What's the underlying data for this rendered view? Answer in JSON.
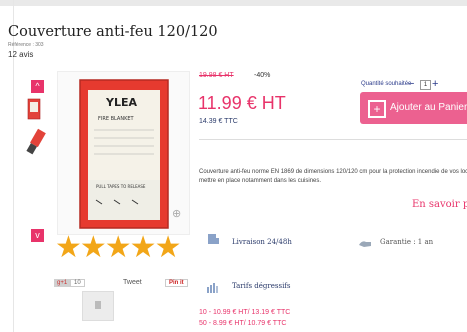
{
  "product": {
    "title": "Couverture anti-feu 120/120",
    "reference": "Référence : 303",
    "reviews": "12 avis",
    "rating_stars": 4.5
  },
  "gallery": {
    "up_arrow": "^",
    "down_arrow": "v",
    "zoom_symbol": "⊕",
    "stars_glyphs": "★★★★★",
    "packaging_brand": "YLEA",
    "packaging_subtitle": "FIRE BLANKET",
    "packaging_note": "PULL TAPES TO RELEASE"
  },
  "social": {
    "gplus": "g+1",
    "gplus_count": "10",
    "tweet": "Tweet",
    "pin": "Pin it"
  },
  "pricing": {
    "old_price": "19.98 € HT",
    "discount": "-40%",
    "price_ht": "11.99 € HT",
    "price_ttc": "14.39 € TTC"
  },
  "cart": {
    "qty_label": "Quantité souhaitée",
    "qty_minus": "−",
    "qty_value": "1",
    "qty_plus": "+",
    "add_label": "Ajouter au Panier",
    "cart_icon_glyph": "+"
  },
  "description": {
    "text": "Couverture anti-feu norme EN 1869 de dimensions 120/120 cm pour la protection incendie de vos locaux, à mettre en place notamment dans les cuisines.",
    "learn_more": "En savoir plus"
  },
  "features": {
    "delivery": "Livraison 24/48h",
    "warranty": "Garantie : 1 an",
    "tiered_title": "Tarifs dégressifs"
  },
  "tiers": [
    {
      "label": "10 - 10.99 € HT/ 13.19 € TTC"
    },
    {
      "label": "50 - 8.99 € HT/ 10.79 € TTC"
    }
  ],
  "colors": {
    "accent": "#e8336a",
    "button": "#ec6190",
    "star": "#f2a618",
    "navy": "#2a3a6a"
  }
}
